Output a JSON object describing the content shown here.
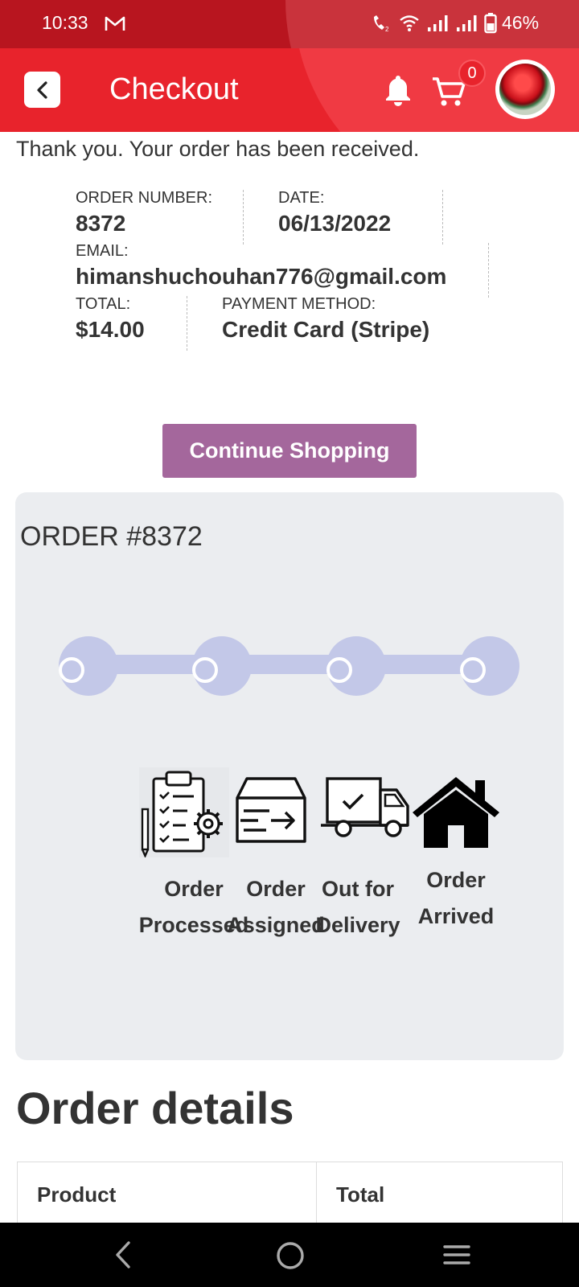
{
  "status_bar": {
    "time": "10:33",
    "battery": "46%"
  },
  "app_bar": {
    "title": "Checkout",
    "cart_count": "0"
  },
  "confirmation": {
    "thanks_message": "Thank you. Your order has been received.",
    "order_number_label": "ORDER NUMBER:",
    "order_number": "8372",
    "date_label": "DATE:",
    "date": "06/13/2022",
    "email_label": "EMAIL:",
    "email": "himanshuchouhan776@gmail.com",
    "total_label": "TOTAL:",
    "total": "$14.00",
    "payment_label": "PAYMENT METHOD:",
    "payment": "Credit Card (Stripe)"
  },
  "continue_button": "Continue Shopping",
  "tracker": {
    "heading": "ORDER #8372",
    "steps": [
      {
        "line1": "Order",
        "line2": "Processed",
        "icon": "clipboard-gear-icon"
      },
      {
        "line1": "Order",
        "line2": "Assigned",
        "icon": "box-arrow-icon"
      },
      {
        "line1": "Out for",
        "line2": "Delivery",
        "icon": "delivery-truck-icon"
      },
      {
        "line1": "Order",
        "line2": "Arrived",
        "icon": "house-icon"
      }
    ]
  },
  "order_details": {
    "title": "Order details",
    "columns": [
      "Product",
      "Total"
    ]
  },
  "colors": {
    "header_red": "#e8232c",
    "status_red": "#b8151f",
    "button_purple": "#a4679c",
    "tracker_track": "#c3c8e8",
    "card_bg": "#ebedf0"
  }
}
